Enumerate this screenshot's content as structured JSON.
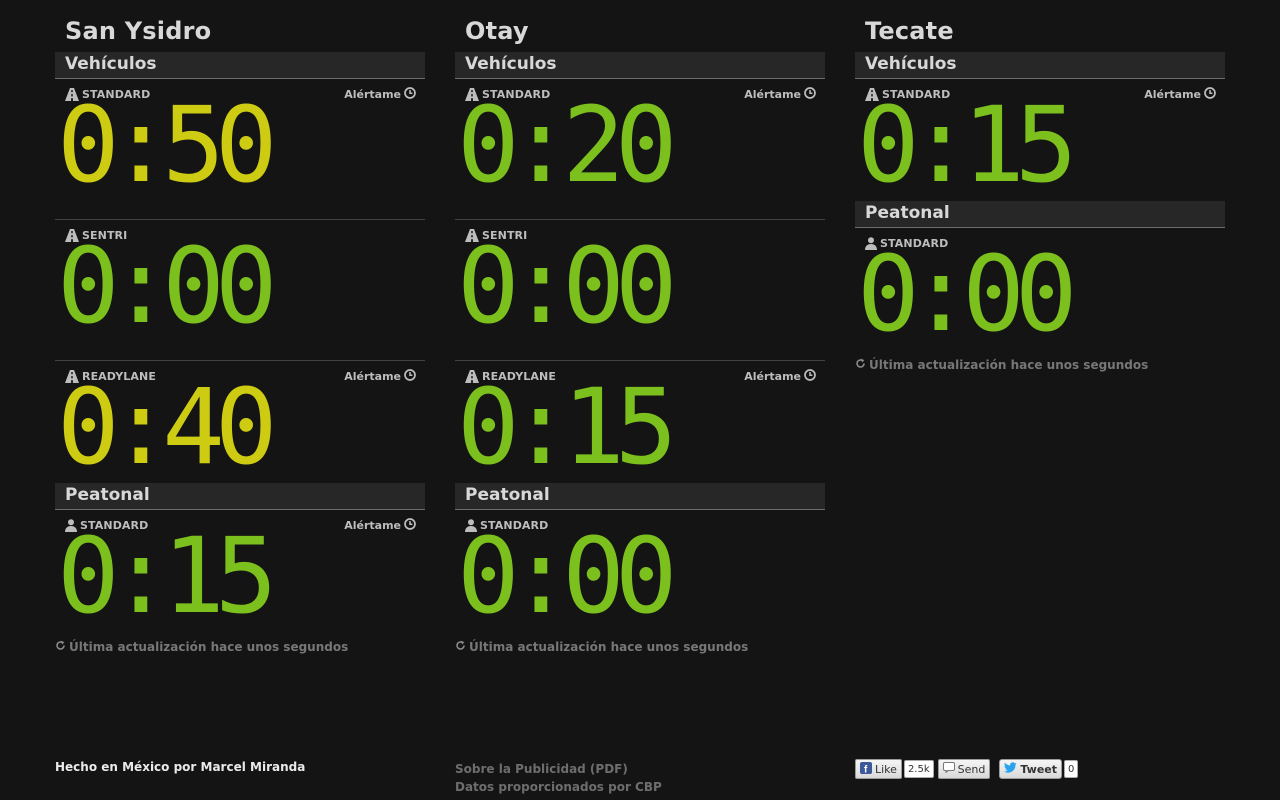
{
  "colors": {
    "background": "#141414",
    "short_wait": "#7cc01e",
    "medium_wait": "#cdcc12",
    "header_bg": "#272727"
  },
  "crossings": [
    {
      "name": "San Ysidro",
      "sections": [
        {
          "title": "Vehículos",
          "lanes": [
            {
              "type": "STANDARD",
              "icon": "road-icon",
              "time": "0:50",
              "status": "medium",
              "alert_label": "Alértame"
            },
            {
              "type": "SENTRI",
              "icon": "road-icon",
              "time": "0:00",
              "status": "short",
              "alert_label": ""
            },
            {
              "type": "READYLANE",
              "icon": "road-icon",
              "time": "0:40",
              "status": "medium",
              "alert_label": "Alértame"
            }
          ]
        },
        {
          "title": "Peatonal",
          "lanes": [
            {
              "type": "STANDARD",
              "icon": "pedestrian-icon",
              "time": "0:15",
              "status": "short",
              "alert_label": "Alértame"
            }
          ]
        }
      ],
      "updated": "Última actualización hace unos segundos"
    },
    {
      "name": "Otay",
      "sections": [
        {
          "title": "Vehículos",
          "lanes": [
            {
              "type": "STANDARD",
              "icon": "road-icon",
              "time": "0:20",
              "status": "short",
              "alert_label": "Alértame"
            },
            {
              "type": "SENTRI",
              "icon": "road-icon",
              "time": "0:00",
              "status": "short",
              "alert_label": ""
            },
            {
              "type": "READYLANE",
              "icon": "road-icon",
              "time": "0:15",
              "status": "short",
              "alert_label": "Alértame"
            }
          ]
        },
        {
          "title": "Peatonal",
          "lanes": [
            {
              "type": "STANDARD",
              "icon": "pedestrian-icon",
              "time": "0:00",
              "status": "short",
              "alert_label": ""
            }
          ]
        }
      ],
      "updated": "Última actualización hace unos segundos"
    },
    {
      "name": "Tecate",
      "sections": [
        {
          "title": "Vehículos",
          "lanes": [
            {
              "type": "STANDARD",
              "icon": "road-icon",
              "time": "0:15",
              "status": "short",
              "alert_label": "Alértame"
            }
          ]
        },
        {
          "title": "Peatonal",
          "lanes": [
            {
              "type": "STANDARD",
              "icon": "pedestrian-icon",
              "time": "0:00",
              "status": "short",
              "alert_label": ""
            }
          ]
        }
      ],
      "updated": "Última actualización hace unos segundos"
    }
  ],
  "footer": {
    "credit": "Hecho en México por Marcel Miranda",
    "ads_link": "Sobre la Publicidad (PDF)",
    "data_source": "Datos proporcionados por CBP",
    "social": {
      "like_label": "Like",
      "like_count": "2.5k",
      "send_label": "Send",
      "tweet_label": "Tweet",
      "tweet_count": "0"
    }
  }
}
